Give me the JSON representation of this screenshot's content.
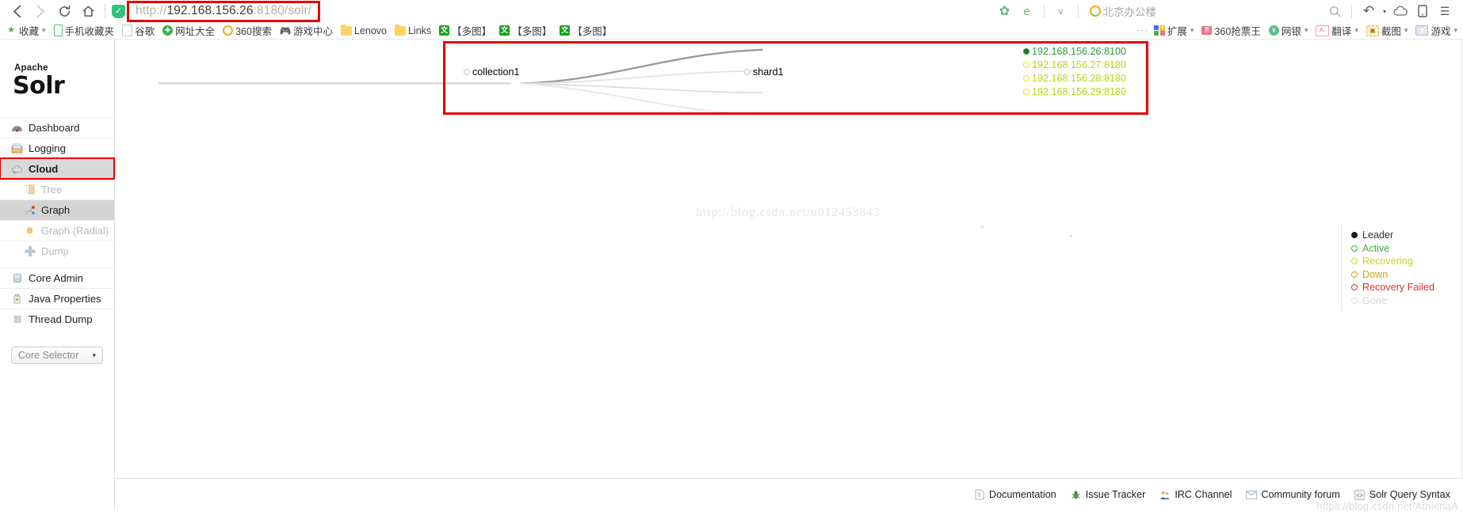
{
  "browser": {
    "nav": {
      "back": "‹",
      "forward": "›",
      "reload": "⟳",
      "home": "⌂"
    },
    "url": {
      "scheme": "http://",
      "host": "192.168.156.26",
      "rest": ":8180/solr/",
      "full": "http://192.168.156.26:8180/solr/"
    },
    "right_icons": [
      {
        "name": "flower-icon",
        "glyph": "✿"
      },
      {
        "name": "edge-e-icon",
        "glyph": "e"
      },
      {
        "name": "chevron-down-icon",
        "glyph": "∨"
      }
    ],
    "geo_label": "北京办公楼",
    "toolbar_right": [
      {
        "name": "search-icon",
        "glyph": "⚲"
      },
      {
        "name": "undo-icon",
        "glyph": "↶"
      },
      {
        "name": "undo-caret-icon",
        "glyph": "▾"
      },
      {
        "name": "cloud-icon",
        "glyph": "☁"
      },
      {
        "name": "phone-icon",
        "glyph": "⎕"
      },
      {
        "name": "menu-icon",
        "glyph": "☰"
      }
    ]
  },
  "bookmarks": {
    "items": [
      {
        "label": "收藏",
        "icon": "star-icon",
        "caret": true
      },
      {
        "label": "手机收藏夹",
        "icon": "phone-icon",
        "caret": false
      },
      {
        "label": "谷歌",
        "icon": "page-icon",
        "caret": false
      },
      {
        "label": "网址大全",
        "icon": "green-plus-icon",
        "caret": false
      },
      {
        "label": "360搜索",
        "icon": "360-ring-icon",
        "caret": false
      },
      {
        "label": "游戏中心",
        "icon": "gamepad-icon",
        "caret": false
      },
      {
        "label": "Lenovo",
        "icon": "folder-icon",
        "caret": false
      },
      {
        "label": "Links",
        "icon": "folder-icon",
        "caret": false
      },
      {
        "label": "【多图】",
        "icon": "duo-icon",
        "caret": false
      },
      {
        "label": "【多图】",
        "icon": "duo-icon",
        "caret": false
      },
      {
        "label": "【多图】",
        "icon": "duo-icon",
        "caret": false
      }
    ],
    "right_items": [
      {
        "label": "扩展",
        "icon": "extensions-icon",
        "caret": true
      },
      {
        "label": "360抢票王",
        "icon": "ticket-icon",
        "caret": false
      },
      {
        "label": "网银",
        "icon": "bank-shield-icon",
        "caret": true
      },
      {
        "label": "翻译",
        "icon": "translate-icon",
        "caret": true
      },
      {
        "label": "截图",
        "icon": "capture-icon",
        "caret": true
      },
      {
        "label": "游戏",
        "icon": "game-icon",
        "caret": true
      }
    ]
  },
  "solr": {
    "logo": {
      "apache": "Apache",
      "name": "Solr"
    },
    "nav": [
      {
        "label": "Dashboard",
        "icon": "dashboard-icon",
        "glyph": "◔",
        "state": "normal",
        "sub": false
      },
      {
        "label": "Logging",
        "icon": "logging-icon",
        "glyph": "✉",
        "state": "normal",
        "sub": false
      },
      {
        "label": "Cloud",
        "icon": "cloud-icon",
        "glyph": "☁",
        "state": "selected",
        "sub": false
      },
      {
        "label": "Tree",
        "icon": "tree-icon",
        "glyph": "▤",
        "state": "disabled",
        "sub": true
      },
      {
        "label": "Graph",
        "icon": "graph-icon",
        "glyph": "⁂",
        "state": "active",
        "sub": true
      },
      {
        "label": "Graph (Radial)",
        "icon": "radial-icon",
        "glyph": "✱",
        "state": "disabled",
        "sub": true
      },
      {
        "label": "Dump",
        "icon": "dump-icon",
        "glyph": "☸",
        "state": "disabled",
        "sub": true
      },
      {
        "label": "Core Admin",
        "icon": "core-admin-icon",
        "glyph": "▤",
        "state": "normal",
        "sub": false
      },
      {
        "label": "Java Properties",
        "icon": "java-icon",
        "glyph": "⌸",
        "state": "normal",
        "sub": false
      },
      {
        "label": "Thread Dump",
        "icon": "thread-icon",
        "glyph": "≡",
        "state": "normal",
        "sub": false
      }
    ],
    "core_selector": {
      "label": "Core Selector",
      "caret": "▾"
    },
    "graph": {
      "collection": "collection1",
      "shard": "shard1",
      "replicas": [
        {
          "label": "192.168.156.26:8100",
          "status": "leader",
          "color": "#2e9b41",
          "filled": true
        },
        {
          "label": "192.168.156.27:8180",
          "status": "recovering",
          "color": "#e3e316",
          "filled": false
        },
        {
          "label": "192.168.156.28:8180",
          "status": "recovering",
          "color": "#e3e316",
          "filled": false
        },
        {
          "label": "192.168.156.29:8180",
          "status": "recovering",
          "color": "#e3e316",
          "filled": false
        }
      ],
      "watermark": "http://blog.csdn.net/u012453843"
    },
    "legend": [
      {
        "label": "Leader",
        "color": "#1a1a1a",
        "filled": true
      },
      {
        "label": "Active",
        "color": "#44aa44",
        "filled": false
      },
      {
        "label": "Recovering",
        "color": "#d8d81c",
        "filled": false
      },
      {
        "label": "Down",
        "color": "#d4a017",
        "filled": false
      },
      {
        "label": "Recovery Failed",
        "color": "#e03030",
        "filled": false
      },
      {
        "label": "Gone",
        "color": "#d6d6d6",
        "filled": false
      }
    ],
    "footer": {
      "links": [
        {
          "label": "Documentation",
          "icon": "document-icon",
          "glyph": "☰"
        },
        {
          "label": "Issue Tracker",
          "icon": "bug-icon",
          "glyph": "✽"
        },
        {
          "label": "IRC Channel",
          "icon": "people-icon",
          "glyph": "♟"
        },
        {
          "label": "Community forum",
          "icon": "envelope-icon",
          "glyph": "✉"
        },
        {
          "label": "Solr Query Syntax",
          "icon": "code-icon",
          "glyph": "‹›"
        }
      ],
      "watermark": "https://blog.csdn.net/AthlenaA"
    }
  }
}
